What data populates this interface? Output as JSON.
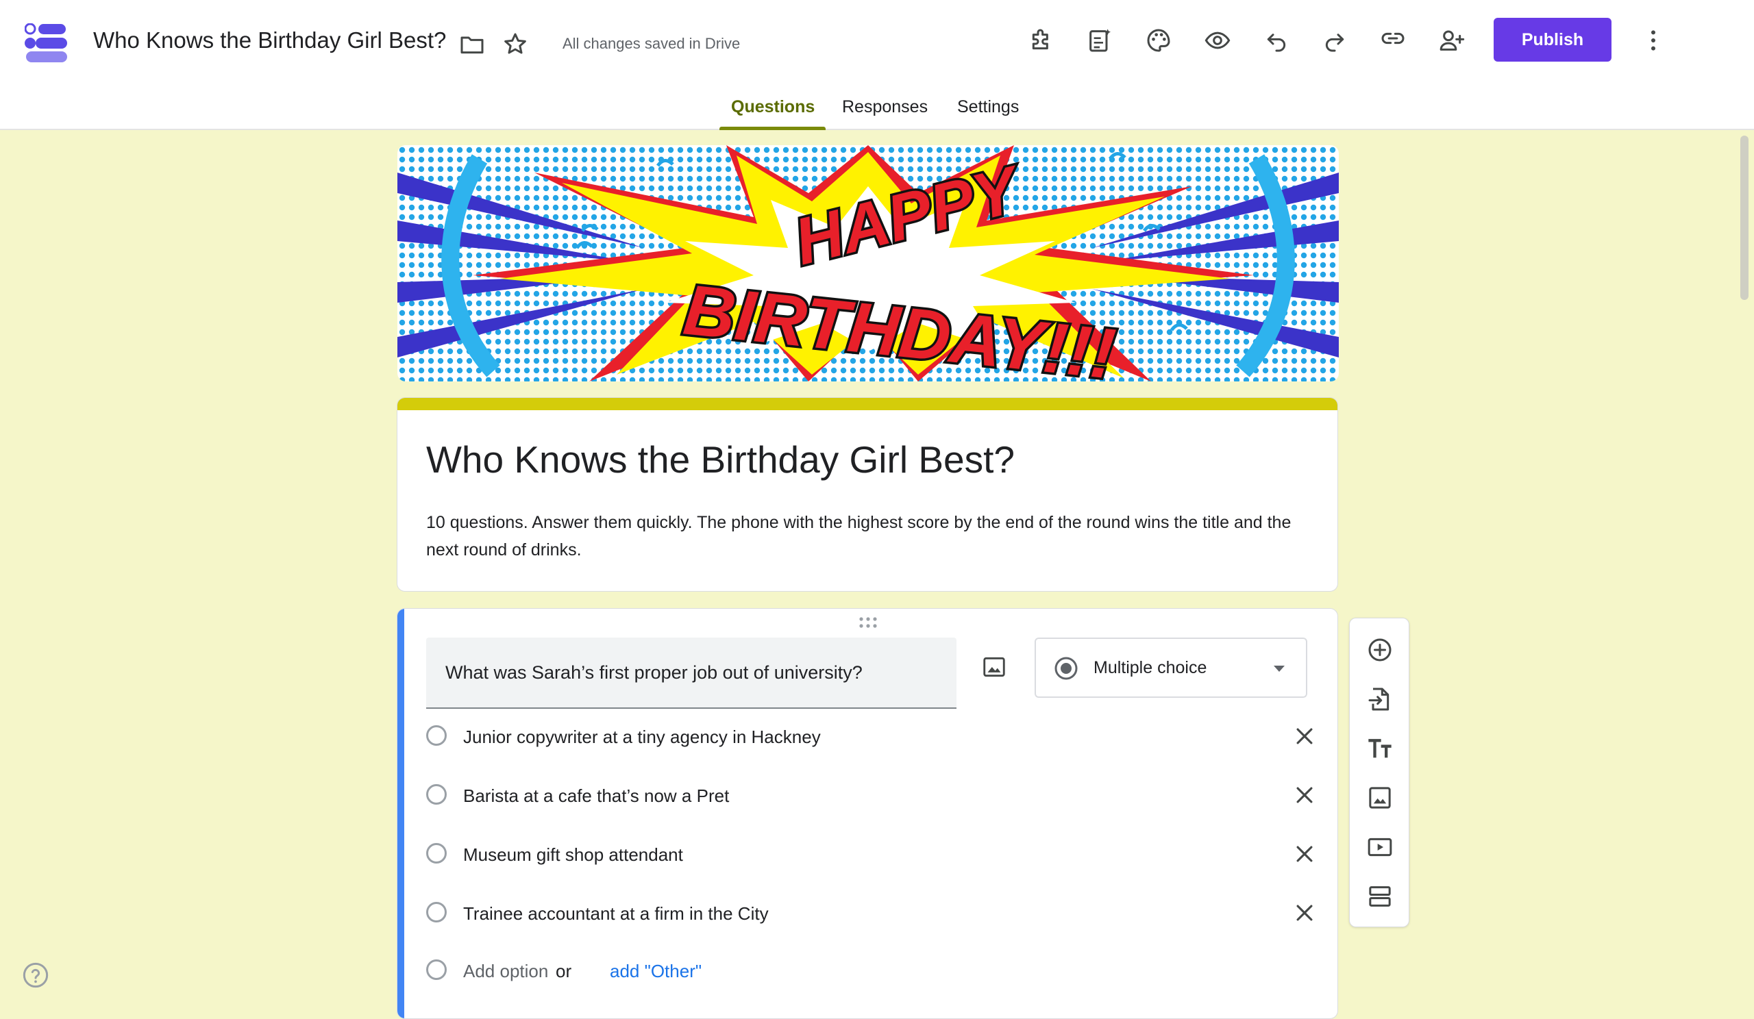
{
  "header": {
    "doc_title": "Who Knows the Birthday Girl Best?",
    "save_status": "All changes saved in Drive",
    "publish_label": "Publish",
    "icons": [
      "folder-icon",
      "star-icon",
      "addons-icon",
      "ai-form-icon",
      "palette-icon",
      "preview-eye-icon",
      "undo-icon",
      "redo-icon",
      "link-icon",
      "add-collaborator-icon",
      "more-vert-icon"
    ],
    "accent_color": "#673ae6"
  },
  "tabs": [
    {
      "label": "Questions",
      "active": true
    },
    {
      "label": "Responses",
      "active": false
    },
    {
      "label": "Settings",
      "active": false
    }
  ],
  "banner": {
    "line1": "HAPPY",
    "line2": "BIRTHDAY!!!"
  },
  "form": {
    "title": "Who Knows the Birthday Girl Best?",
    "description": "10 questions. Answer them quickly. The phone with the highest score by the end of the round wins the title and the next round of drinks.",
    "theme_color": "#d4cc0a",
    "background_color": "#f5f6c9"
  },
  "question": {
    "text": "What was Sarah’s first proper job out of university?",
    "type_label": "Multiple choice",
    "options": [
      "Junior copywriter at a tiny agency in Hackney",
      "Barista at a cafe that’s now a Pret",
      "Museum gift shop attendant",
      "Trainee accountant at a firm in the City"
    ],
    "add_option_label": "Add option",
    "or_label": "or",
    "add_other_label": "add \"Other\""
  },
  "side_toolbar": {
    "icons": [
      "add-question-icon",
      "import-questions-icon",
      "add-title-icon",
      "add-image-icon",
      "add-video-icon",
      "add-section-icon"
    ]
  }
}
